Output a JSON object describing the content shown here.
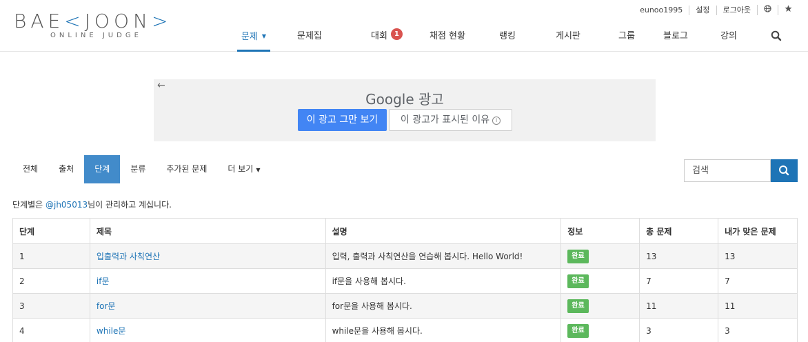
{
  "logo": {
    "main_left": "BAE",
    "bracket_left": "<",
    "main_right": "JOON",
    "bracket_right": ">",
    "subtitle": "ONLINE JUDGE"
  },
  "topbar": {
    "username": "eunoo1995",
    "settings": "설정",
    "logout": "로그아웃"
  },
  "nav": {
    "items": [
      {
        "label": "문제"
      },
      {
        "label": "문제집"
      },
      {
        "label": "대회",
        "badge": "1"
      },
      {
        "label": "채점 현황"
      },
      {
        "label": "랭킹"
      },
      {
        "label": "게시판"
      },
      {
        "label": "그룹"
      },
      {
        "label": "블로그"
      },
      {
        "label": "강의"
      }
    ]
  },
  "ad": {
    "title_brand": "Google",
    "title_suffix": "광고",
    "stop_button": "이 광고 그만 보기",
    "why_button": "이 광고가 표시된 이유"
  },
  "subtabs": [
    "전체",
    "출처",
    "단계",
    "분류",
    "추가된 문제",
    "더 보기"
  ],
  "search": {
    "placeholder": "검색"
  },
  "manager": {
    "prefix": "단계별은 ",
    "user": "@jh05013",
    "suffix": "님이 관리하고 계십니다."
  },
  "table": {
    "headers": [
      "단계",
      "제목",
      "설명",
      "정보",
      "총 문제",
      "내가 맞은 문제"
    ],
    "rows": [
      {
        "step": "1",
        "title": "입출력과 사칙연산",
        "desc": "입력, 출력과 사칙연산을 연습해 봅시다. Hello World!",
        "info": "완료",
        "total": "13",
        "solved": "13"
      },
      {
        "step": "2",
        "title": "if문",
        "desc": "if문을 사용해 봅시다.",
        "info": "완료",
        "total": "7",
        "solved": "7"
      },
      {
        "step": "3",
        "title": "for문",
        "desc": "for문을 사용해 봅시다.",
        "info": "완료",
        "total": "11",
        "solved": "11"
      },
      {
        "step": "4",
        "title": "while문",
        "desc": "while문을 사용해 봅시다.",
        "info": "완료",
        "total": "3",
        "solved": "3"
      }
    ]
  },
  "colors": {
    "accent": "#1e74b6",
    "active_tab": "#428bca",
    "success": "#5cb85c",
    "badge": "#d9534f",
    "ad_blue": "#4285f4"
  }
}
